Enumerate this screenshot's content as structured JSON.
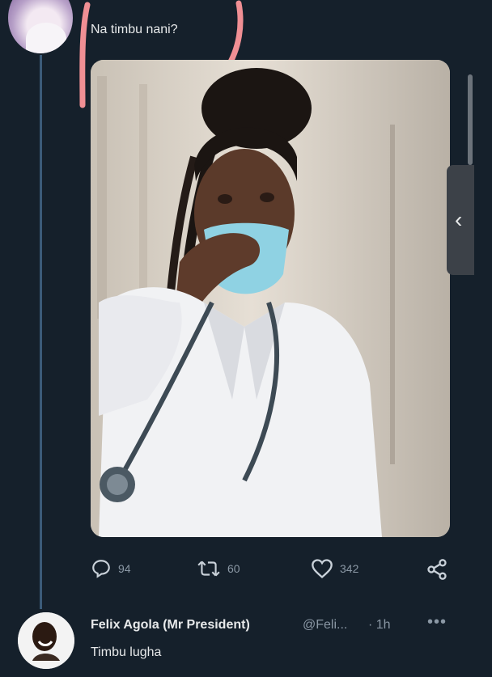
{
  "tweet": {
    "text": "Na timbu nani?",
    "replies_count": "94",
    "retweets_count": "60",
    "likes_count": "342"
  },
  "reply": {
    "name": "Felix Agola (Mr President)",
    "handle": "@Feli...",
    "time": "· 1h",
    "more": "•••",
    "text": "Timbu lugha"
  },
  "icons": {
    "reply": "comment-icon",
    "retweet": "retweet-icon",
    "like": "heart-icon",
    "share": "share-icon",
    "gallery_prev": "chevron-left-icon"
  },
  "colors": {
    "background": "#15202b",
    "annotation": "#f08f94",
    "thread_line": "#3b5b79"
  }
}
